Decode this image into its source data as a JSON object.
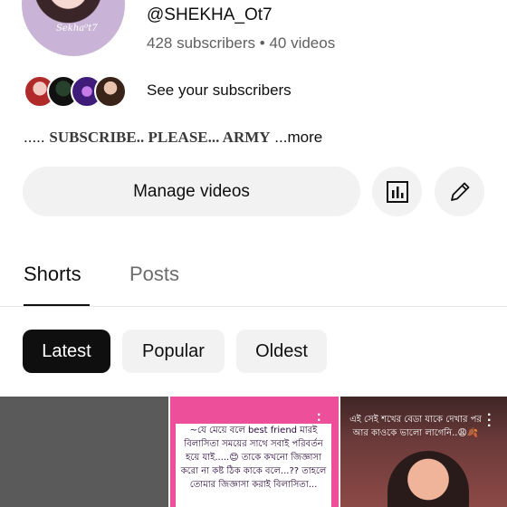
{
  "channel": {
    "avatar_watermark": "Sekha⁰t7",
    "handle": "@SHEKHA_Ot7",
    "subscribers": "428 subscribers",
    "separator": "•",
    "videos": "40 videos",
    "see_subscribers": "See your subscribers",
    "description_prefix": ".....",
    "description_bold": "SUBSCRIBE.. PLEASE... ARMY",
    "description_more": "...more"
  },
  "actions": {
    "manage_videos": "Manage videos",
    "analytics_icon": "analytics-icon",
    "edit_icon": "pencil-icon"
  },
  "tabs": [
    {
      "label": "Shorts",
      "selected": true
    },
    {
      "label": "Posts",
      "selected": false
    }
  ],
  "filters": [
    {
      "label": "Latest",
      "selected": true
    },
    {
      "label": "Popular",
      "selected": false
    },
    {
      "label": "Oldest",
      "selected": false
    }
  ],
  "shorts": [
    {
      "text": ""
    },
    {
      "text": "~যে মেয়ে বলে best friend মারই বিলাসিতা সময়ের সাথে সবাই পরিবর্তন হয়ে যাই.....😊 তাকে কখনো জিজ্ঞাসা করো না কষ্ট ঠিক কাকে বলে...?? তাহলে তোমার জিজ্ঞাসা করাই বিলাসিতা..."
    },
    {
      "text": "এই সেই শখের বেডা যাকে দেখার পর আর কাওকে ভালো লাগেনি..😩🍂"
    }
  ],
  "colors": {
    "chip_selected_bg": "#0f0f0f",
    "chip_bg": "#f2f2f2",
    "secondary_text": "#606060",
    "short_pink": "#ee4f9a"
  }
}
